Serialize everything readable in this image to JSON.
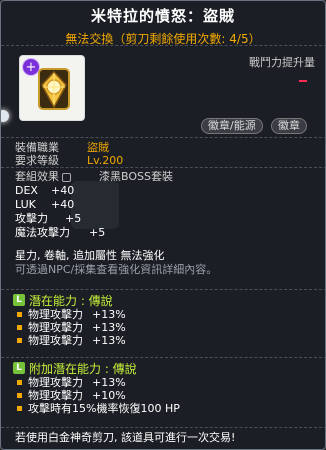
{
  "header": {
    "title": "米特拉的憤怒：盜賊",
    "subtitle": "無法交換（剪刀剩餘使用次數: 4/5）"
  },
  "item_panel": {
    "power_label": "戰鬥力提升量",
    "buttons": [
      "徽章/能源",
      "徽章"
    ],
    "plus_glyph": "+"
  },
  "requirements": [
    {
      "label": "裝備職業",
      "value": "盜賊"
    },
    {
      "label": "要求等級",
      "value": "Lv.200"
    }
  ],
  "set_effect": {
    "label": "套組效果",
    "value": "漆黑BOSS套裝"
  },
  "stats": [
    {
      "label": "DEX",
      "value": "+40"
    },
    {
      "label": "LUK",
      "value": "+40"
    },
    {
      "label": "攻擊力",
      "value": "+5"
    },
    {
      "label": "魔法攻擊力",
      "value": "+5"
    }
  ],
  "extra": {
    "traits": "星力, 卷軸, 追加屬性 無法強化",
    "note": "可透過NPC/採集查看強化資訊詳細內容。"
  },
  "potential": {
    "icon_letter": "L",
    "header": "潛在能力 : 傳說",
    "lines": [
      {
        "name": "物理攻擊力",
        "value": "+13%"
      },
      {
        "name": "物理攻擊力",
        "value": "+13%"
      },
      {
        "name": "物理攻擊力",
        "value": "+13%"
      }
    ]
  },
  "bonus_potential": {
    "icon_letter": "L",
    "header": "附加潛在能力 : 傳說",
    "lines": [
      {
        "name": "物理攻擊力",
        "value": "+13%"
      },
      {
        "name": "物理攻擊力",
        "value": "+10%"
      },
      {
        "name": "攻擊時有15%機率恢復100 HP",
        "value": ""
      }
    ]
  },
  "footer": "若使用白金神奇剪刀, 該道具可進行一次交易!",
  "colors": {
    "accent": "#f2a900",
    "potential_green": "#c6ef3b",
    "badge_purple": "#7b2fd6",
    "power_red": "#ff2a55"
  }
}
